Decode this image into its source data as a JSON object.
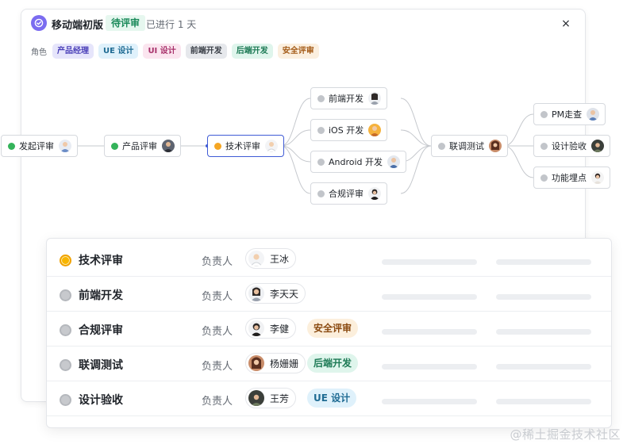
{
  "header": {
    "title": "移动端初版",
    "status": "待评审",
    "duration": "已进行 1 天",
    "close_label": "×"
  },
  "roles": {
    "label": "角色",
    "items": [
      {
        "label": "产品经理",
        "bg": "#e6e5fb",
        "fg": "#4a3fb8"
      },
      {
        "label": "UE 设计",
        "bg": "#dff1fb",
        "fg": "#1f6b93"
      },
      {
        "label": "UI 设计",
        "bg": "#fbe5ef",
        "fg": "#a8326b"
      },
      {
        "label": "前端开发",
        "bg": "#e6e8ec",
        "fg": "#3a3f47"
      },
      {
        "label": "后端开发",
        "bg": "#dff5ec",
        "fg": "#1d7a55"
      },
      {
        "label": "安全评审",
        "bg": "#fbefdf",
        "fg": "#a35a16"
      }
    ]
  },
  "flow": {
    "nodes": [
      {
        "label": "发起评审",
        "status": "green"
      },
      {
        "label": "产品评审",
        "status": "green"
      },
      {
        "label": "技术评审",
        "status": "orange"
      },
      {
        "label": "前端开发",
        "status": "gray"
      },
      {
        "label": "iOS 开发",
        "status": "gray"
      },
      {
        "label": "Android 开发",
        "status": "gray"
      },
      {
        "label": "合规评审",
        "status": "gray"
      },
      {
        "label": "联调测试",
        "status": "gray"
      },
      {
        "label": "PM走查",
        "status": "gray"
      },
      {
        "label": "设计验收",
        "status": "gray"
      },
      {
        "label": "功能埋点",
        "status": "gray"
      }
    ]
  },
  "table": {
    "owner_label": "负责人",
    "rows": [
      {
        "title": "技术评审",
        "status": "orange",
        "owner": "王冰",
        "role": ""
      },
      {
        "title": "前端开发",
        "status": "gray",
        "owner": "李天天",
        "role": ""
      },
      {
        "title": "合规评审",
        "status": "gray",
        "owner": "李健",
        "role": "安全评审",
        "role_bg": "#fcefdc",
        "role_fg": "#8a4a10"
      },
      {
        "title": "联调测试",
        "status": "gray",
        "owner": "杨姗姗",
        "role": "后端开发",
        "role_bg": "#dff5ec",
        "role_fg": "#1d7a55"
      },
      {
        "title": "设计验收",
        "status": "gray",
        "owner": "王芳",
        "role": "UE 设计",
        "role_bg": "#dff1fb",
        "role_fg": "#1f6b93"
      }
    ]
  },
  "watermark": "@稀土掘金技术社区",
  "colors": {
    "accent": "#3f5bd6",
    "brand": "#7b6cf0",
    "success": "#34b35a",
    "warning": "#f5a623"
  }
}
